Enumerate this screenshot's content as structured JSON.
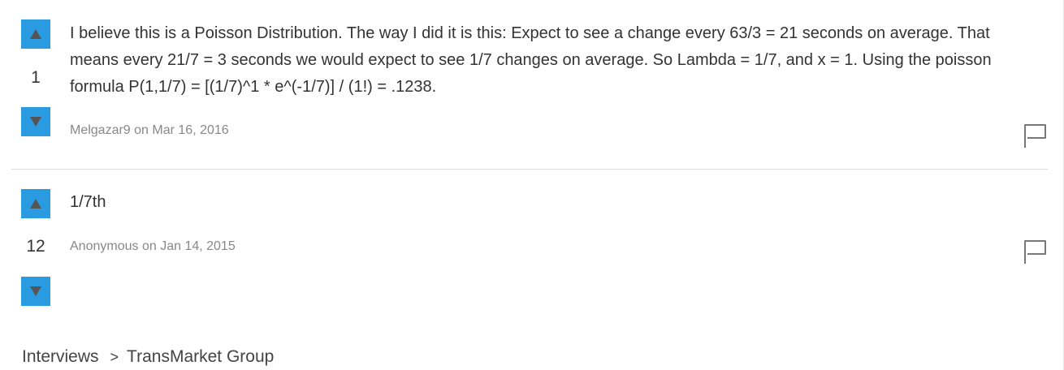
{
  "answers": [
    {
      "upvote_icon": "up-triangle-icon",
      "votes": "1",
      "downvote_icon": "down-triangle-icon",
      "text": "I believe this is a Poisson Distribution. The way I did it is this: Expect to see a change every 63/3 = 21 seconds on average. That means every 21/7 = 3 seconds we would expect to see 1/7 changes on average. So Lambda = 1/7, and x = 1. Using the poisson formula P(1,1/7) = [(1/7)^1 * e^(-1/7)] / (1!) = .1238.",
      "author": "Melgazar9",
      "on": "on",
      "date": "Mar 16, 2016",
      "flag_icon": "flag-icon"
    },
    {
      "upvote_icon": "up-triangle-icon",
      "votes": "12",
      "downvote_icon": "down-triangle-icon",
      "text": "1/7th",
      "author": "Anonymous",
      "on": "on",
      "date": "Jan 14, 2015",
      "flag_icon": "flag-icon"
    }
  ],
  "breadcrumb": {
    "items": [
      "Interviews",
      "TransMarket Group"
    ],
    "separator": ">"
  },
  "colors": {
    "vote_button": "#2a9be0",
    "vote_arrow": "#555555",
    "meta_text": "#888888",
    "divider": "#dddddd"
  }
}
